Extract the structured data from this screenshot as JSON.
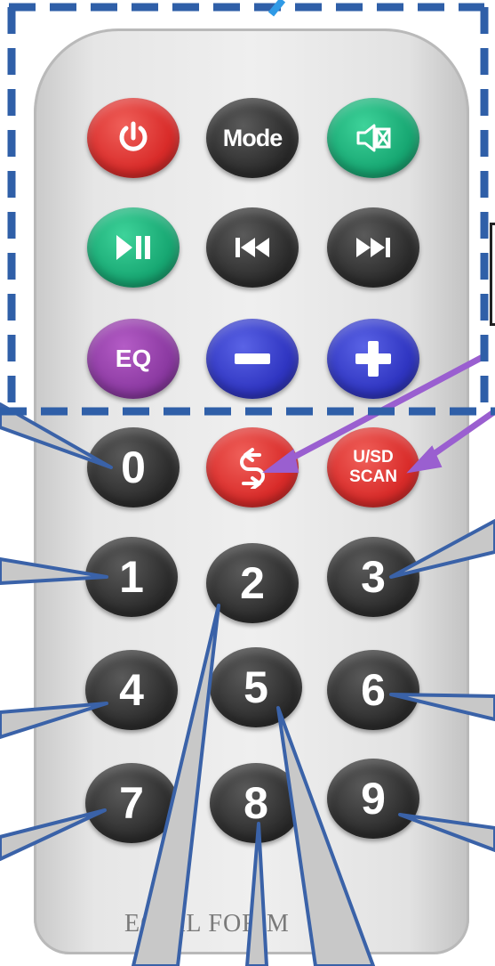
{
  "remote": {
    "brand_text": "ECIAL FOR M",
    "buttons": {
      "power": {
        "icon": "power-icon",
        "color": "#d92c2a"
      },
      "mode": {
        "label": "Mode",
        "color": "#2e2e2e"
      },
      "mute": {
        "icon": "mute-icon",
        "color": "#18a873"
      },
      "play_pause": {
        "icon": "play-pause-icon",
        "color": "#18a873"
      },
      "prev": {
        "icon": "previous-icon",
        "color": "#2e2e2e"
      },
      "next": {
        "icon": "next-icon",
        "color": "#2e2e2e"
      },
      "eq": {
        "label": "EQ",
        "color": "#8c3aa2"
      },
      "vol_down": {
        "icon": "minus-icon",
        "color": "#3036c2"
      },
      "vol_up": {
        "icon": "plus-icon",
        "color": "#3036c2"
      },
      "zero": {
        "label": "0"
      },
      "repeat": {
        "icon": "repeat-icon",
        "color": "#d92c2a"
      },
      "scan": {
        "line1": "U/SD",
        "line2": "SCAN",
        "color": "#d92c2a"
      },
      "one": {
        "label": "1"
      },
      "two": {
        "label": "2"
      },
      "three": {
        "label": "3"
      },
      "four": {
        "label": "4"
      },
      "five": {
        "label": "5"
      },
      "six": {
        "label": "6"
      },
      "seven": {
        "label": "7"
      },
      "eight": {
        "label": "8"
      },
      "nine": {
        "label": "9"
      }
    }
  },
  "annotations": {
    "outline_color": "#2f5fa8",
    "callout_color": "#3a62a8",
    "callout_fill": "#c8c8c8",
    "arrow_color": "#9a5fd0"
  }
}
